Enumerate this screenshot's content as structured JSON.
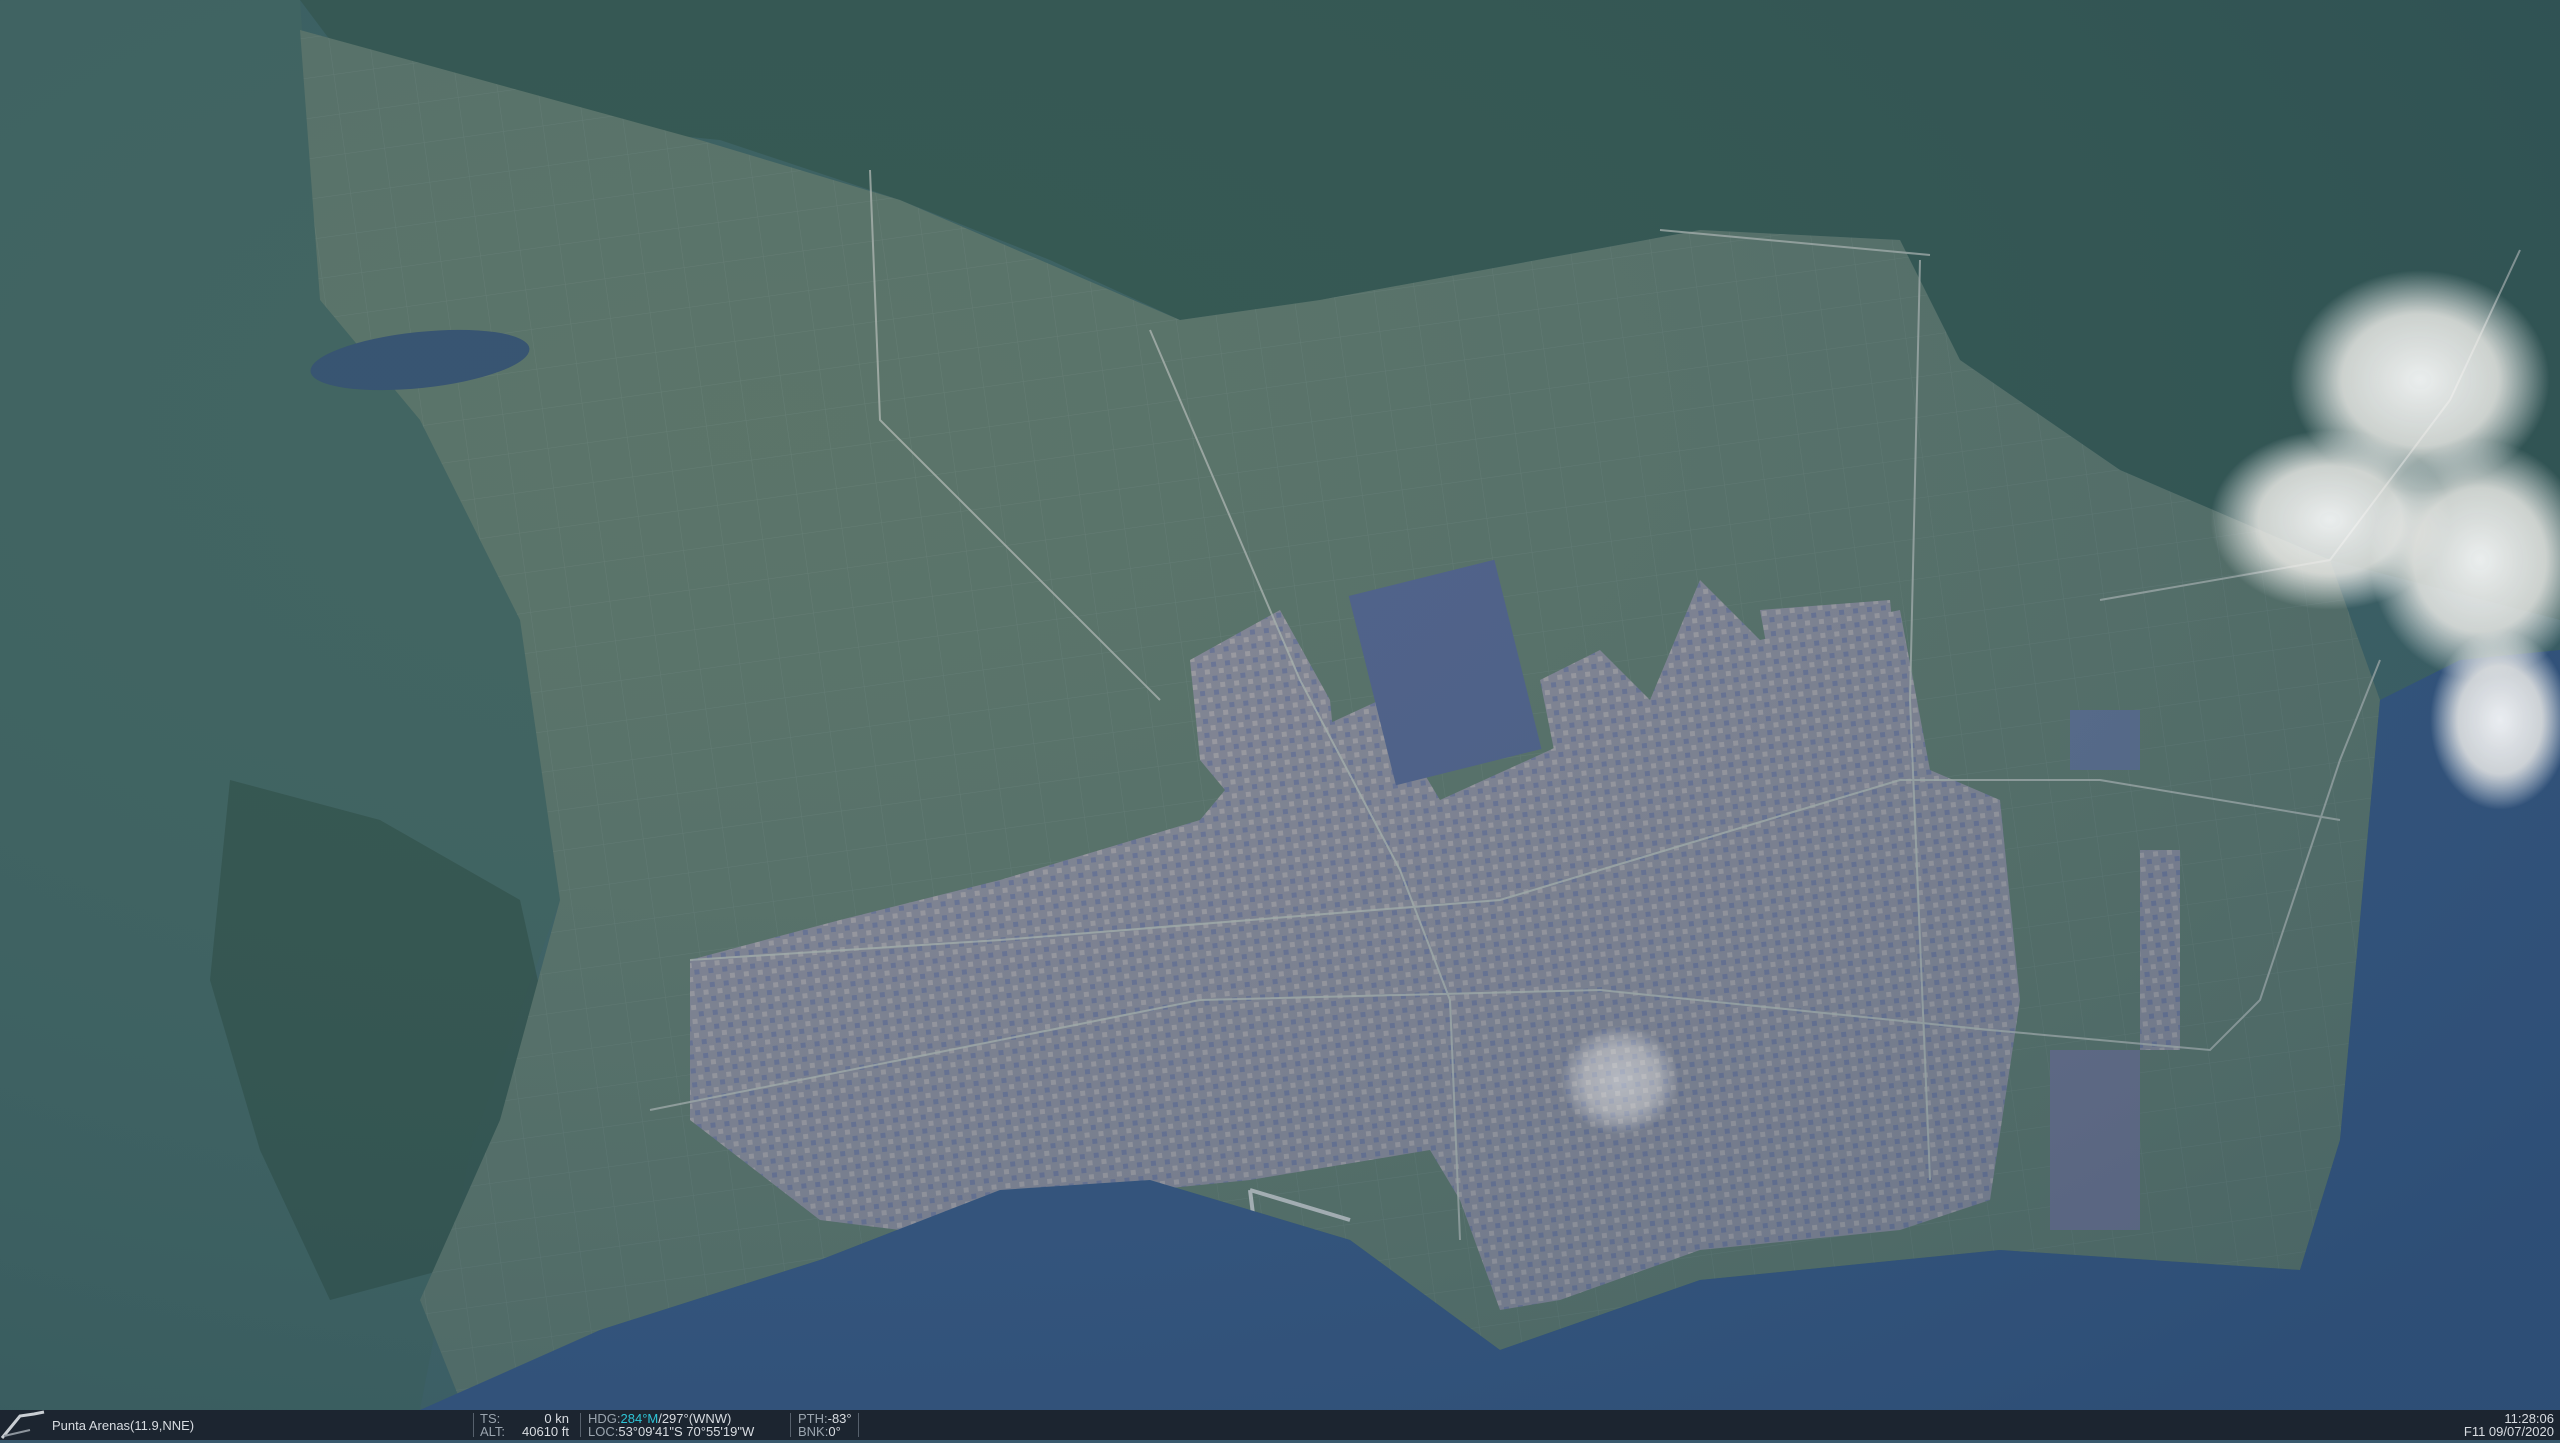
{
  "hud": {
    "location": "Punta Arenas(11.9,NNE)",
    "ts_label": "TS:",
    "ts_value": "0 kn",
    "alt_label": "ALT:",
    "alt_value": "40610 ft",
    "hdg_label": "HDG:",
    "hdg_magnetic": "284°M",
    "hdg_rest": "/297°(WNW)",
    "loc_label": "LOC:",
    "loc_value": "53°09'41\"S 70°55'19\"W",
    "pth_label": "PTH:",
    "pth_value": "-83°",
    "bnk_label": "BNK:",
    "bnk_value": "0°",
    "time": "11:28:06",
    "date": "F11 09/07/2020"
  },
  "colors": {
    "ocean": "#2e4e78",
    "forest": "#2f5446",
    "grass": "#58705e",
    "city": "#8d8b92",
    "hud_bg": "#1c2530",
    "accent": "#2ec4d6"
  }
}
